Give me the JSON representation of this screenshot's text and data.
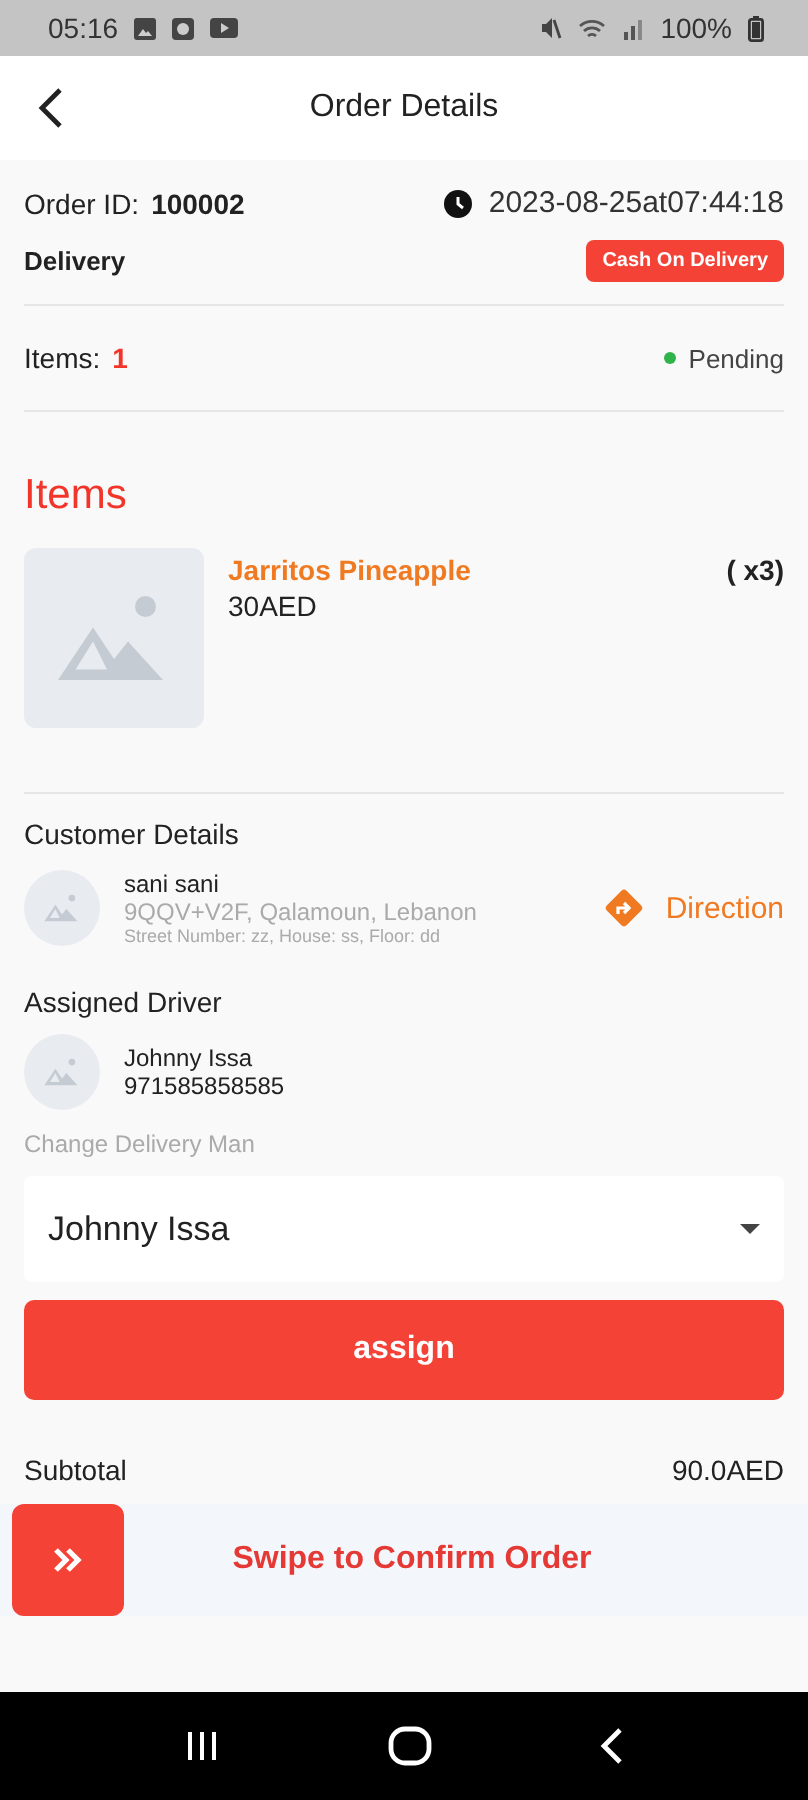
{
  "status_bar": {
    "time": "05:16",
    "battery": "100%"
  },
  "app_bar": {
    "title": "Order Details"
  },
  "order": {
    "id_label": "Order ID:",
    "id": "100002",
    "datetime": "2023-08-25at07:44:18",
    "type": "Delivery",
    "payment": "Cash On Delivery",
    "items_label": "Items:",
    "items_count": "1",
    "status": "Pending"
  },
  "items_section": {
    "title": "Items",
    "items": [
      {
        "name": "Jarritos Pineapple",
        "price": "30AED",
        "quantity": "( x3)"
      }
    ]
  },
  "customer": {
    "title": "Customer Details",
    "name": "sani sani",
    "address": "9QQV+V2F, Qalamoun, Lebanon",
    "details": "Street Number: zz, House: ss, Floor: dd",
    "direction": "Direction"
  },
  "driver": {
    "title": "Assigned Driver",
    "name": "Johnny Issa",
    "phone": "971585858585"
  },
  "change_driver": {
    "label": "Change Delivery Man",
    "value": "Johnny Issa",
    "button": "assign"
  },
  "summary": [
    {
      "label": "Subtotal",
      "value": "90.0AED"
    }
  ],
  "swipe": {
    "label": "Swipe to Confirm Order"
  }
}
